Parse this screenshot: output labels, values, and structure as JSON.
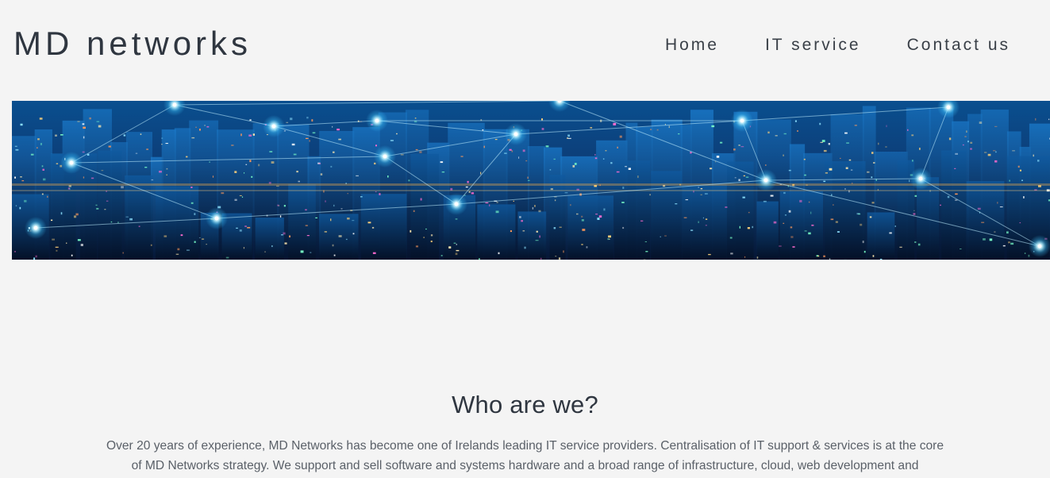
{
  "header": {
    "brand": "MD networks",
    "nav": [
      {
        "label": "Home"
      },
      {
        "label": "IT service"
      },
      {
        "label": "Contact us"
      }
    ]
  },
  "hero": {
    "image": "city-network-skyline-image"
  },
  "about": {
    "heading": "Who are we?",
    "body": "Over 20 years of experience, MD Networks has become one of Irelands leading IT service providers. Centralisation of IT support & services is at the core of MD Networks strategy. We support and sell software and systems hardware and a broad range of infrastructure, cloud, web development and"
  },
  "colors": {
    "page_background": "#f4f4f4",
    "text_dark": "#2f3640",
    "text_body": "#5a6068",
    "hero_accent": "#3fc8ff"
  }
}
